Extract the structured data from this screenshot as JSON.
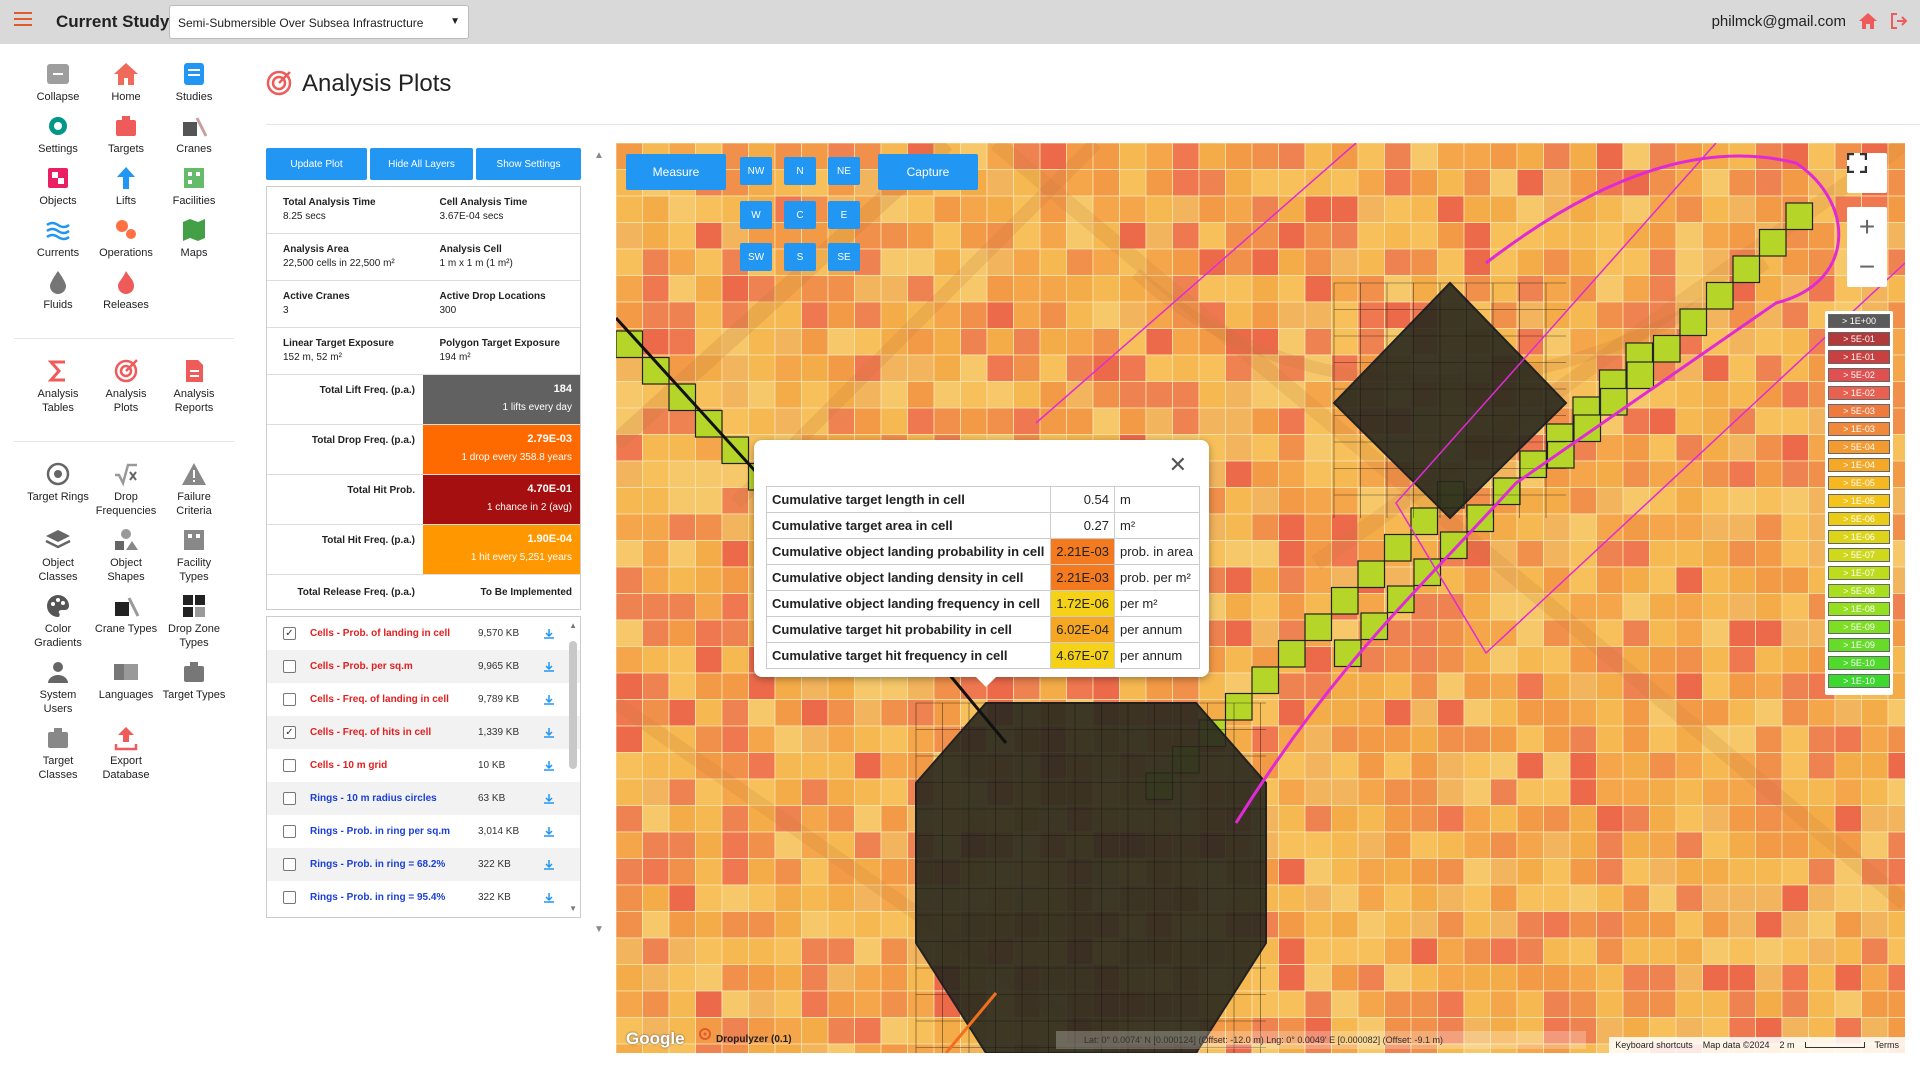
{
  "header": {
    "study_label": "Current Study:",
    "study_value": "Semi-Submersible Over Subsea Infrastructure",
    "user_email": "philmck@gmail.com"
  },
  "sidebar": {
    "group1": [
      {
        "label": "Collapse",
        "icon": "collapse-icon"
      },
      {
        "label": "Home",
        "icon": "home-icon"
      },
      {
        "label": "Studies",
        "icon": "studies-icon"
      },
      {
        "label": "Settings",
        "icon": "settings-icon"
      },
      {
        "label": "Targets",
        "icon": "targets-icon"
      },
      {
        "label": "Cranes",
        "icon": "cranes-icon"
      },
      {
        "label": "Objects",
        "icon": "objects-icon"
      },
      {
        "label": "Lifts",
        "icon": "lifts-icon"
      },
      {
        "label": "Facilities",
        "icon": "facilities-icon"
      },
      {
        "label": "Currents",
        "icon": "currents-icon"
      },
      {
        "label": "Operations",
        "icon": "operations-icon"
      },
      {
        "label": "Maps",
        "icon": "maps-icon"
      },
      {
        "label": "Fluids",
        "icon": "fluids-icon"
      },
      {
        "label": "Releases",
        "icon": "releases-icon"
      }
    ],
    "group2": [
      {
        "label": "Analysis Tables",
        "icon": "sigma-icon"
      },
      {
        "label": "Analysis Plots",
        "icon": "target-plot-icon"
      },
      {
        "label": "Analysis Reports",
        "icon": "report-icon"
      }
    ],
    "group3": [
      {
        "label": "Target Rings",
        "icon": "rings-icon"
      },
      {
        "label": "Drop Frequencies",
        "icon": "sqrt-icon"
      },
      {
        "label": "Failure Criteria",
        "icon": "warning-icon"
      },
      {
        "label": "Object Classes",
        "icon": "layers-icon"
      },
      {
        "label": "Object Shapes",
        "icon": "shapes-icon"
      },
      {
        "label": "Facility Types",
        "icon": "facility-types-icon"
      },
      {
        "label": "Color Gradients",
        "icon": "palette-icon"
      },
      {
        "label": "Crane Types",
        "icon": "crane-types-icon"
      },
      {
        "label": "Drop Zone Types",
        "icon": "dropzone-icon"
      },
      {
        "label": "System Users",
        "icon": "users-icon"
      },
      {
        "label": "Languages",
        "icon": "languages-icon"
      },
      {
        "label": "Target Types",
        "icon": "target-types-icon"
      },
      {
        "label": "Target Classes",
        "icon": "target-classes-icon"
      },
      {
        "label": "Export Database",
        "icon": "export-icon"
      }
    ]
  },
  "page": {
    "title": "Analysis Plots"
  },
  "panel": {
    "buttons": {
      "update": "Update Plot",
      "hide": "Hide All Layers",
      "show": "Show Settings"
    },
    "info": [
      [
        {
          "k": "Total Analysis Time",
          "v": "8.25 secs"
        },
        {
          "k": "Cell Analysis Time",
          "v": "3.67E-04 secs"
        }
      ],
      [
        {
          "k": "Analysis Area",
          "v": "22,500 cells in 22,500 m²"
        },
        {
          "k": "Analysis Cell",
          "v": "1 m x 1 m (1 m²)"
        }
      ],
      [
        {
          "k": "Active Cranes",
          "v": "3"
        },
        {
          "k": "Active Drop Locations",
          "v": "300"
        }
      ],
      [
        {
          "k": "Linear Target Exposure",
          "v": "152 m, 52 m²"
        },
        {
          "k": "Polygon Target Exposure",
          "v": "194 m²"
        }
      ]
    ],
    "stats": [
      {
        "label": "Total Lift Freq. (p.a.)",
        "value": "184",
        "sub": "1 lifts every day",
        "color": "#616161"
      },
      {
        "label": "Total Drop Freq. (p.a.)",
        "value": "2.79E-03",
        "sub": "1 drop every 358.8 years",
        "color": "#ff6a00"
      },
      {
        "label": "Total Hit Prob.",
        "value": "4.70E-01",
        "sub": "1 chance in 2 (avg)",
        "color": "#a50f0f"
      },
      {
        "label": "Total Hit Freq. (p.a.)",
        "value": "1.90E-04",
        "sub": "1 hit every 5,251 years",
        "color": "#ff9800"
      }
    ],
    "release": {
      "label": "Total Release Freq. (p.a.)",
      "value": "To Be Implemented"
    },
    "layers": [
      {
        "name": "Cells - Prob. of landing in cell",
        "size": "9,570 KB",
        "checked": true,
        "color": "red"
      },
      {
        "name": "Cells - Prob. per sq.m",
        "size": "9,965 KB",
        "checked": false,
        "color": "red"
      },
      {
        "name": "Cells - Freq. of landing in cell",
        "size": "9,789 KB",
        "checked": false,
        "color": "red"
      },
      {
        "name": "Cells - Freq. of hits in cell",
        "size": "1,339 KB",
        "checked": true,
        "color": "red"
      },
      {
        "name": "Cells - 10 m grid",
        "size": "10 KB",
        "checked": false,
        "color": "red"
      },
      {
        "name": "Rings - 10 m radius circles",
        "size": "63 KB",
        "checked": false,
        "color": "blue"
      },
      {
        "name": "Rings - Prob. in ring per sq.m",
        "size": "3,014 KB",
        "checked": false,
        "color": "blue"
      },
      {
        "name": "Rings - Prob. in ring = 68.2%",
        "size": "322 KB",
        "checked": false,
        "color": "blue"
      },
      {
        "name": "Rings - Prob. in ring = 95.4%",
        "size": "322 KB",
        "checked": false,
        "color": "blue"
      }
    ]
  },
  "map": {
    "measure": "Measure",
    "capture": "Capture",
    "directions": [
      "NW",
      "N",
      "NE",
      "W",
      "C",
      "E",
      "SW",
      "S",
      "SE"
    ],
    "legend": [
      {
        "label": "> 1E+00",
        "color": "#5a5a5a"
      },
      {
        "label": "> 5E-01",
        "color": "#b23a3a"
      },
      {
        "label": "> 1E-01",
        "color": "#c94040"
      },
      {
        "label": "> 5E-02",
        "color": "#e05050"
      },
      {
        "label": "> 1E-02",
        "color": "#e86050"
      },
      {
        "label": "> 5E-03",
        "color": "#ee7a40"
      },
      {
        "label": "> 1E-03",
        "color": "#f08a3a"
      },
      {
        "label": "> 5E-04",
        "color": "#f39a30"
      },
      {
        "label": "> 1E-04",
        "color": "#f5a828"
      },
      {
        "label": "> 5E-05",
        "color": "#f5b820"
      },
      {
        "label": "> 1E-05",
        "color": "#f2c41c"
      },
      {
        "label": "> 5E-06",
        "color": "#e8cc18"
      },
      {
        "label": "> 1E-06",
        "color": "#dcd418"
      },
      {
        "label": "> 5E-07",
        "color": "#cfd81a"
      },
      {
        "label": "> 1E-07",
        "color": "#bcdc1c"
      },
      {
        "label": "> 5E-08",
        "color": "#a8de1e"
      },
      {
        "label": "> 1E-08",
        "color": "#94e020"
      },
      {
        "label": "> 5E-09",
        "color": "#7ede24"
      },
      {
        "label": "> 1E-09",
        "color": "#66dc28"
      },
      {
        "label": "> 5E-10",
        "color": "#50da2c"
      },
      {
        "label": "> 1E-10",
        "color": "#3cd830"
      }
    ],
    "footer": {
      "google": "Google",
      "brand": "Dropulyzer (0.1)",
      "coords": "Lat: 0° 0.0074' N [0.000124] (Offset: -12.0 m) Lng: 0° 0.0049' E [0.000082] (Offset: -9.1 m)",
      "keyboard": "Keyboard shortcuts",
      "mapdata": "Map data ©2024",
      "scale": "2 m",
      "terms": "Terms"
    }
  },
  "popup": {
    "rows": [
      {
        "k": "Cumulative target length in cell",
        "v": "0.54",
        "u": "m",
        "color": ""
      },
      {
        "k": "Cumulative target area in cell",
        "v": "0.27",
        "u": "m²",
        "color": ""
      },
      {
        "k": "Cumulative object landing probability in cell",
        "v": "2.21E-03",
        "u": "prob. in area",
        "color": "#f47a1f"
      },
      {
        "k": "Cumulative object landing density in cell",
        "v": "2.21E-03",
        "u": "prob. per m²",
        "color": "#f47a1f"
      },
      {
        "k": "Cumulative object landing frequency in cell",
        "v": "1.72E-06",
        "u": "per m²",
        "color": "#f5d118"
      },
      {
        "k": "Cumulative target hit probability in cell",
        "v": "6.02E-04",
        "u": "per annum",
        "color": "#f5a623"
      },
      {
        "k": "Cumulative target hit frequency in cell",
        "v": "4.67E-07",
        "u": "per annum",
        "color": "#f5d118"
      }
    ]
  }
}
